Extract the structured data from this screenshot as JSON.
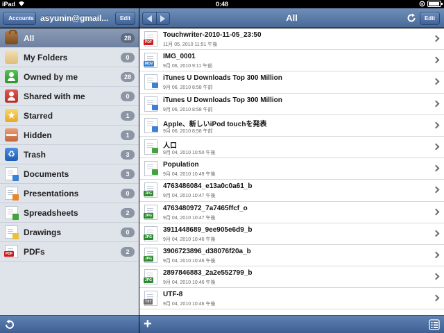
{
  "status": {
    "carrier": "iPad",
    "time": "0:48"
  },
  "left_nav": {
    "back_label": "Accounts",
    "title": "asyunin@gmail...",
    "edit_label": "Edit"
  },
  "right_nav": {
    "title": "All",
    "edit_label": "Edit"
  },
  "sidebar": {
    "items": [
      {
        "label": "All",
        "count": "28",
        "icon": "briefcase-icon"
      },
      {
        "label": "My Folders",
        "count": "0",
        "icon": "folder-icon"
      },
      {
        "label": "Owned by me",
        "count": "28",
        "icon": "person-icon"
      },
      {
        "label": "Shared with me",
        "count": "0",
        "icon": "shared-person-icon"
      },
      {
        "label": "Starred",
        "count": "1",
        "icon": "star-icon"
      },
      {
        "label": "Hidden",
        "count": "1",
        "icon": "hidden-box-icon"
      },
      {
        "label": "Trash",
        "count": "3",
        "icon": "recycle-icon"
      },
      {
        "label": "Documents",
        "count": "3",
        "icon": "document-icon"
      },
      {
        "label": "Presentations",
        "count": "0",
        "icon": "presentation-icon"
      },
      {
        "label": "Spreadsheets",
        "count": "2",
        "icon": "spreadsheet-icon"
      },
      {
        "label": "Drawings",
        "count": "0",
        "icon": "drawing-icon"
      },
      {
        "label": "PDFs",
        "count": "2",
        "icon": "pdf-icon"
      }
    ],
    "star_glyph": "★",
    "trash_glyph": "♻",
    "pdf_tag": "PDF"
  },
  "files": [
    {
      "name": "Touchwriter-2010-11-05_23:50",
      "date": "11月 05, 2010 11:51 午後",
      "type": "PDF"
    },
    {
      "name": "IMG_0001",
      "date": "9月 06, 2010 9:11 午前",
      "type": "MOV"
    },
    {
      "name": "iTunes U Downloads Top 300 Million",
      "date": "9月 06, 2010 8:58 午前",
      "type": "DOC"
    },
    {
      "name": "iTunes U Downloads Top 300 Million",
      "date": "9月 06, 2010 8:58 午前",
      "type": "DOC"
    },
    {
      "name": "Apple、新しいiPod touchを発表",
      "date": "9月 06, 2010 8:58 午前",
      "type": "DOC"
    },
    {
      "name": "人口",
      "date": "9月 04, 2010 10:50 午後",
      "type": "XLS"
    },
    {
      "name": "Population",
      "date": "9月 04, 2010 10:49 午後",
      "type": "XLS"
    },
    {
      "name": "4763486084_e13a0c0a61_b",
      "date": "9月 04, 2010 10:47 午後",
      "type": "JPG"
    },
    {
      "name": "4763480972_7a7465ffcf_o",
      "date": "9月 04, 2010 10:47 午後",
      "type": "JPG"
    },
    {
      "name": "3911448689_9ee905e6d9_b",
      "date": "9月 04, 2010 10:46 午後",
      "type": "JPG"
    },
    {
      "name": "3906723896_d38076f20a_b",
      "date": "9月 04, 2010 10:46 午後",
      "type": "JPG"
    },
    {
      "name": "2897846883_2a2e552799_b",
      "date": "9月 04, 2010 10:46 午後",
      "type": "JPG"
    },
    {
      "name": "UTF-8",
      "date": "9月 04, 2010 10:46 午後",
      "type": "TXT"
    }
  ],
  "bottom": {
    "add_glyph": "+"
  },
  "colors": {
    "navbar": "#5a7aa8",
    "sidebar_bg": "#dfe3ea",
    "selected": "#7a8ba8",
    "badge": "#8c95a3"
  }
}
